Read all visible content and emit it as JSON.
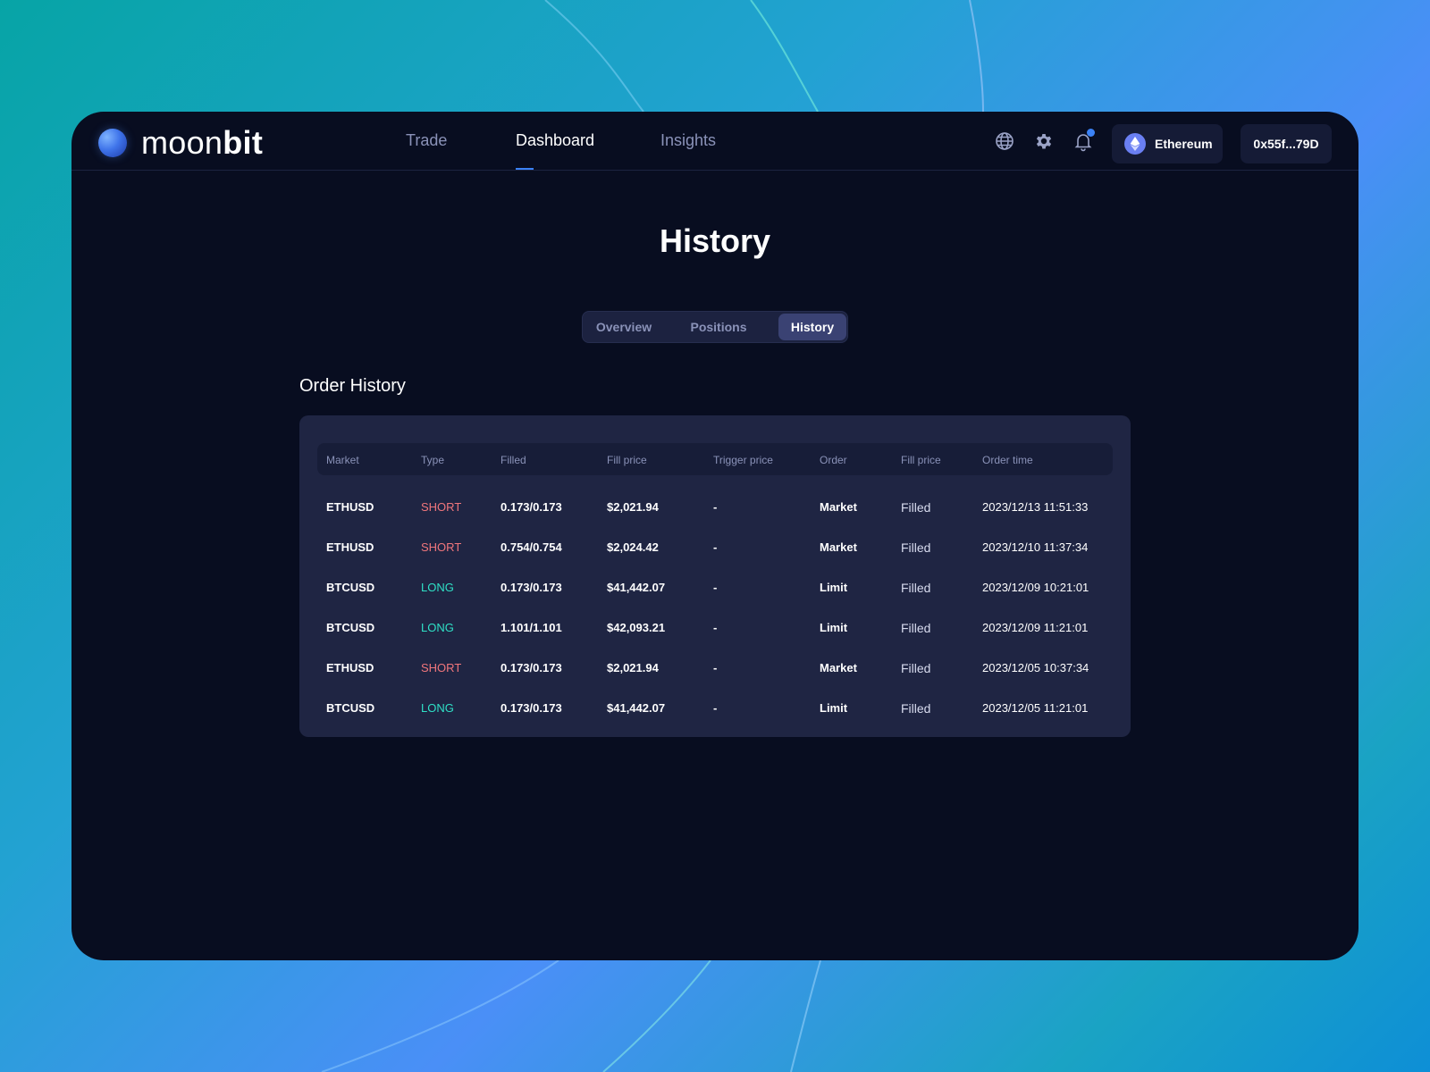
{
  "app": {
    "logo_light": "moon",
    "logo_bold": "bit"
  },
  "nav": {
    "items": [
      "Trade",
      "Dashboard",
      "Insights"
    ],
    "active": "Dashboard"
  },
  "header": {
    "chain_label": "Ethereum",
    "wallet_address": "0x55f...79D"
  },
  "page": {
    "title": "History"
  },
  "tabs": {
    "items": [
      "Overview",
      "Positions",
      "History"
    ],
    "active": "History"
  },
  "section": {
    "title": "Order History"
  },
  "table": {
    "columns": [
      "Market",
      "Type",
      "Filled",
      "Fill price",
      "Trigger price",
      "Order",
      "Fill price",
      "Order time"
    ],
    "rows": [
      [
        "ETHUSD",
        "SHORT",
        "0.173/0.173",
        "$2,021.94",
        "-",
        "Market",
        "Filled",
        "2023/12/13  11:51:33"
      ],
      [
        "ETHUSD",
        "SHORT",
        "0.754/0.754",
        "$2,024.42",
        "-",
        "Market",
        "Filled",
        "2023/12/10  11:37:34"
      ],
      [
        "BTCUSD",
        "LONG",
        "0.173/0.173",
        "$41,442.07",
        "-",
        "Limit",
        "Filled",
        "2023/12/09  10:21:01"
      ],
      [
        "BTCUSD",
        "LONG",
        "1.101/1.101",
        "$42,093.21",
        "-",
        "Limit",
        "Filled",
        "2023/12/09  11:21:01"
      ],
      [
        "ETHUSD",
        "SHORT",
        "0.173/0.173",
        "$2,021.94",
        "-",
        "Market",
        "Filled",
        "2023/12/05 10:37:34"
      ],
      [
        "BTCUSD",
        "LONG",
        "0.173/0.173",
        "$41,442.07",
        "-",
        "Limit",
        "Filled",
        "2023/12/05 11:21:01"
      ]
    ]
  },
  "colors": {
    "short": "#f0767c",
    "long": "#2fe0c6",
    "accent": "#3b82f6"
  },
  "icons": [
    "globe-icon",
    "gear-icon",
    "bell-icon",
    "ethereum-icon"
  ]
}
